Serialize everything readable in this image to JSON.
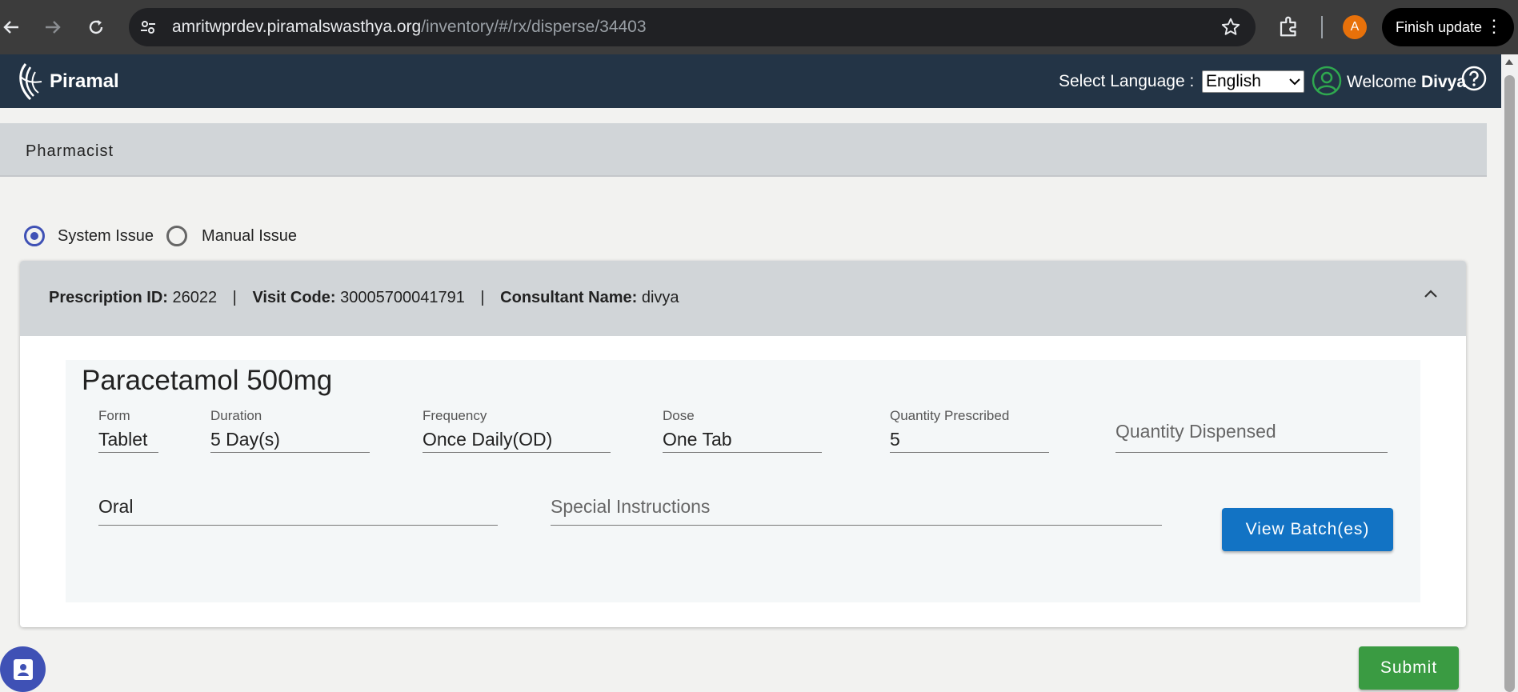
{
  "browser": {
    "url_host": "amritwprdev.piramalswasthya.org",
    "url_path": "/inventory/#/rx/disperse/34403",
    "profile_initial": "A",
    "finish_update_label": "Finish update"
  },
  "header": {
    "logo_text": "Piramal",
    "language_label": "Select Language :",
    "language_value": "English",
    "welcome_text": "Welcome",
    "user_name": "Divya"
  },
  "page": {
    "role_title": "Pharmacist",
    "issue_options": [
      {
        "label": "System Issue",
        "selected": true
      },
      {
        "label": "Manual Issue",
        "selected": false
      }
    ]
  },
  "prescription": {
    "id_label": "Prescription ID:",
    "id_value": "26022",
    "visit_label": "Visit Code:",
    "visit_value": "30005700041791",
    "consultant_label": "Consultant Name:",
    "consultant_value": "divya",
    "separator": "|"
  },
  "drug": {
    "name": "Paracetamol 500mg",
    "form_label": "Form",
    "form_value": "Tablet",
    "duration_label": "Duration",
    "duration_value": "5 Day(s)",
    "frequency_label": "Frequency",
    "frequency_value": "Once Daily(OD)",
    "dose_label": "Dose",
    "dose_value": "One Tab",
    "qty_prescribed_label": "Quantity Prescribed",
    "qty_prescribed_value": "5",
    "qty_dispensed_placeholder": "Quantity Dispensed",
    "route_value": "Oral",
    "special_instructions_placeholder": "Special Instructions",
    "view_batches_label": "View Batch(es)"
  },
  "actions": {
    "submit_label": "Submit"
  },
  "colors": {
    "header_bg": "#233446",
    "primary_button": "#1273c4",
    "submit_button": "#3a9b42",
    "radio_accent": "#3f51b5"
  }
}
